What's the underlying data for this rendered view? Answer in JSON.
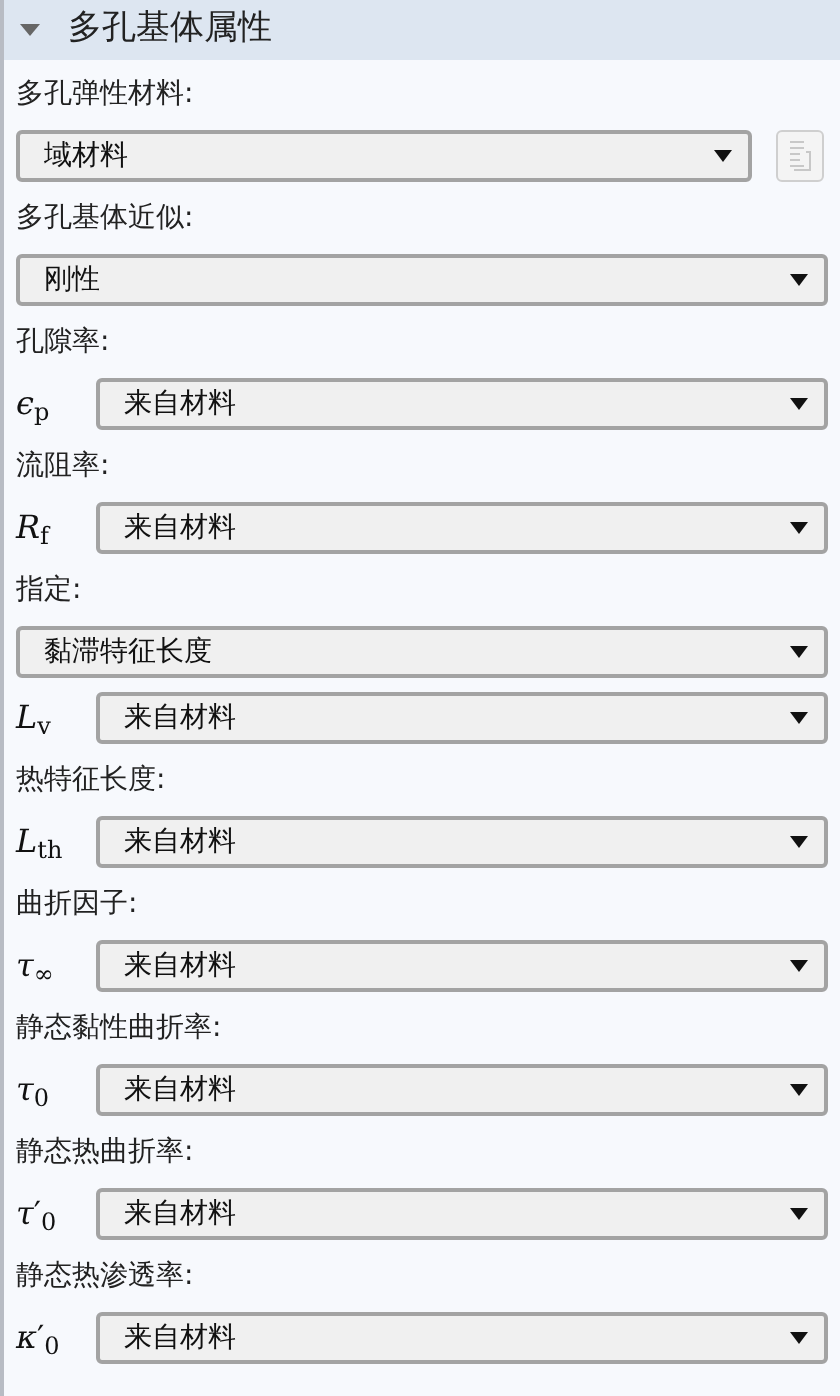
{
  "section": {
    "title": "多孔基体属性",
    "expanded": true
  },
  "rows": [
    {
      "kind": "label",
      "text": "多孔弹性材料:"
    },
    {
      "kind": "select",
      "value": "域材料",
      "side_button": {
        "disabled": true
      }
    },
    {
      "kind": "label",
      "text": "多孔基体近似:"
    },
    {
      "kind": "select",
      "value": "刚性"
    },
    {
      "kind": "label",
      "text": "孔隙率:"
    },
    {
      "kind": "select",
      "symbol": "*ϵ*$_{p}$",
      "value": "来自材料"
    },
    {
      "kind": "label",
      "text": "流阻率:"
    },
    {
      "kind": "select",
      "symbol": "*R*$_{f}$",
      "value": "来自材料"
    },
    {
      "kind": "label",
      "text": "指定:"
    },
    {
      "kind": "select",
      "value": "黏滞特征长度"
    },
    {
      "kind": "select",
      "symbol": "*L*$_{v}$",
      "value": "来自材料"
    },
    {
      "kind": "label",
      "text": "热特征长度:"
    },
    {
      "kind": "select",
      "symbol": "*L*$_{th}$",
      "value": "来自材料"
    },
    {
      "kind": "label",
      "text": "曲折因子:"
    },
    {
      "kind": "select",
      "symbol": "*τ*$_{∞}$",
      "value": "来自材料"
    },
    {
      "kind": "label",
      "text": "静态黏性曲折率:"
    },
    {
      "kind": "select",
      "symbol": "*τ*$_{0}$",
      "value": "来自材料"
    },
    {
      "kind": "label",
      "text": "静态热曲折率:"
    },
    {
      "kind": "select",
      "symbol": "*τ*′$_{0}$",
      "value": "来自材料"
    },
    {
      "kind": "label",
      "text": "静态热渗透率:"
    },
    {
      "kind": "select",
      "symbol": "*κ*′$_{0}$",
      "value": "来自材料"
    }
  ]
}
